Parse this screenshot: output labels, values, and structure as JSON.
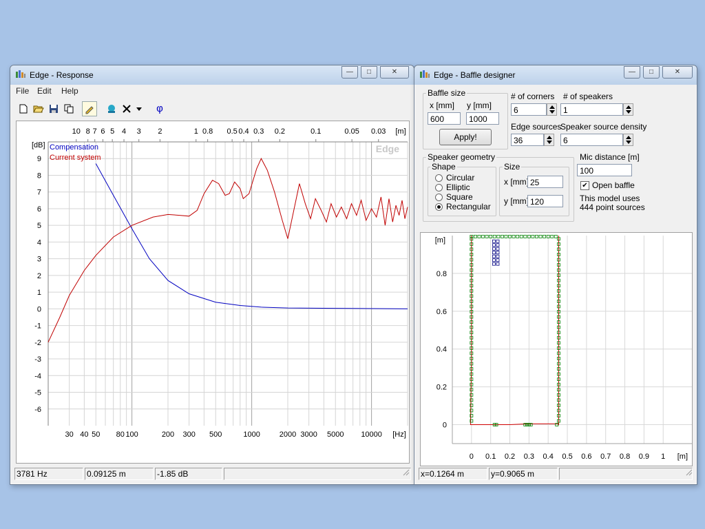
{
  "response_window": {
    "title": "Edge - Response",
    "menu": [
      "File",
      "Edit",
      "Help"
    ],
    "toolbar_icons": [
      "new-file-icon",
      "open-folder-icon",
      "save-icon",
      "copy-icon",
      "pencil-icon",
      "speaker-icon",
      "delete-icon",
      "dropdown-icon",
      "phase-icon"
    ],
    "phase_glyph": "φ",
    "status": [
      "3781 Hz",
      "0.09125 m",
      "-1.85 dB",
      ""
    ]
  },
  "chart_data": {
    "type": "line",
    "xscale": "log",
    "xlim": [
      20,
      20000
    ],
    "ylim": [
      -7,
      10
    ],
    "grid": true,
    "legend": "top-left",
    "watermark": "Edge",
    "ylabel": "[dB]",
    "xlabel": "[Hz]",
    "top_axis_label": "[m]",
    "yticks": [
      9,
      8,
      7,
      6,
      5,
      4,
      3,
      2,
      1,
      0,
      -1,
      -2,
      -3,
      -4,
      -5,
      -6
    ],
    "xtick_labels": [
      {
        "v": 30,
        "t": "30"
      },
      {
        "v": 40,
        "t": "40"
      },
      {
        "v": 50,
        "t": "50"
      },
      {
        "v": 80,
        "t": "80"
      },
      {
        "v": 100,
        "t": "100"
      },
      {
        "v": 200,
        "t": "200"
      },
      {
        "v": 300,
        "t": "300"
      },
      {
        "v": 500,
        "t": "500"
      },
      {
        "v": 1000,
        "t": "1000"
      },
      {
        "v": 2000,
        "t": "2000"
      },
      {
        "v": 3000,
        "t": "3000"
      },
      {
        "v": 5000,
        "t": "5000"
      },
      {
        "v": 10000,
        "t": "10000"
      }
    ],
    "top_tick_labels": [
      {
        "v": 34.3,
        "t": "10"
      },
      {
        "v": 42.9,
        "t": "8"
      },
      {
        "v": 49,
        "t": "7"
      },
      {
        "v": 57.2,
        "t": "6"
      },
      {
        "v": 68.6,
        "t": "5"
      },
      {
        "v": 85.8,
        "t": "4"
      },
      {
        "v": 114.3,
        "t": "3"
      },
      {
        "v": 171.5,
        "t": "2"
      },
      {
        "v": 343,
        "t": "1"
      },
      {
        "v": 428.8,
        "t": "0.8"
      },
      {
        "v": 686,
        "t": "0.5"
      },
      {
        "v": 857.5,
        "t": "0.4"
      },
      {
        "v": 1143,
        "t": "0.3"
      },
      {
        "v": 1715,
        "t": "0.2"
      },
      {
        "v": 3430,
        "t": "0.1"
      },
      {
        "v": 6860,
        "t": "0.05"
      },
      {
        "v": 11433,
        "t": "0.03"
      }
    ],
    "series": [
      {
        "name": "Compensation",
        "color": "#0000c0",
        "points": [
          [
            50,
            8.7
          ],
          [
            70,
            6.8
          ],
          [
            100,
            4.8
          ],
          [
            140,
            3.0
          ],
          [
            200,
            1.7
          ],
          [
            300,
            0.9
          ],
          [
            500,
            0.4
          ],
          [
            800,
            0.2
          ],
          [
            1200,
            0.1
          ],
          [
            2000,
            0.05
          ],
          [
            5000,
            0.03
          ],
          [
            20000,
            0.0
          ]
        ]
      },
      {
        "name": "Current system",
        "color": "#c00000",
        "points": [
          [
            20,
            -2.0
          ],
          [
            25,
            -0.5
          ],
          [
            30,
            0.8
          ],
          [
            40,
            2.3
          ],
          [
            50,
            3.2
          ],
          [
            70,
            4.3
          ],
          [
            100,
            5.0
          ],
          [
            150,
            5.5
          ],
          [
            200,
            5.65
          ],
          [
            250,
            5.6
          ],
          [
            300,
            5.55
          ],
          [
            350,
            5.9
          ],
          [
            400,
            6.9
          ],
          [
            470,
            7.7
          ],
          [
            530,
            7.5
          ],
          [
            600,
            6.8
          ],
          [
            650,
            6.9
          ],
          [
            720,
            7.6
          ],
          [
            800,
            7.2
          ],
          [
            850,
            6.6
          ],
          [
            950,
            6.9
          ],
          [
            1100,
            8.4
          ],
          [
            1200,
            9.0
          ],
          [
            1350,
            8.3
          ],
          [
            1550,
            7.0
          ],
          [
            1800,
            5.3
          ],
          [
            2000,
            4.2
          ],
          [
            2200,
            5.6
          ],
          [
            2500,
            7.5
          ],
          [
            2800,
            6.3
          ],
          [
            3100,
            5.4
          ],
          [
            3400,
            6.6
          ],
          [
            3800,
            5.9
          ],
          [
            4200,
            5.2
          ],
          [
            4600,
            6.3
          ],
          [
            5100,
            5.5
          ],
          [
            5600,
            6.1
          ],
          [
            6200,
            5.4
          ],
          [
            6800,
            6.3
          ],
          [
            7500,
            5.6
          ],
          [
            8200,
            6.5
          ],
          [
            9000,
            5.3
          ],
          [
            10000,
            6.0
          ],
          [
            11000,
            5.5
          ],
          [
            12000,
            6.7
          ],
          [
            13000,
            5.0
          ],
          [
            14000,
            6.6
          ],
          [
            15000,
            5.2
          ],
          [
            16000,
            6.2
          ],
          [
            17000,
            5.6
          ],
          [
            18000,
            6.5
          ],
          [
            19000,
            5.4
          ],
          [
            20000,
            6.1
          ]
        ]
      }
    ]
  },
  "baffle_window": {
    "title": "Edge - Baffle designer",
    "baffle_size": {
      "label": "Baffle size",
      "x_label": "x [mm]",
      "y_label": "y [mm]",
      "x_value": "600",
      "y_value": "1000",
      "apply_label": "Apply!"
    },
    "corners": {
      "label": "# of corners",
      "value": "6"
    },
    "speakers": {
      "label": "# of speakers",
      "value": "1"
    },
    "edge_sources": {
      "label": "Edge sources",
      "value": "36"
    },
    "density": {
      "label": "Speaker source density",
      "value": "6"
    },
    "geometry": {
      "label": "Speaker geometry",
      "shape_label": "Shape",
      "shapes": [
        "Circular",
        "Elliptic",
        "Square",
        "Rectangular"
      ],
      "selected_shape": "Rectangular",
      "size_label": "Size",
      "x_label": "x [mm]",
      "x_value": "25",
      "y_label": "y [mm]",
      "y_value": "120"
    },
    "mic": {
      "label": "Mic distance [m]",
      "value": "100"
    },
    "open_baffle": {
      "label": "Open baffle",
      "checked": true
    },
    "model_info": [
      "This model uses",
      "444 point sources"
    ],
    "status": [
      "x=0.1264 m",
      "y=0.9065 m",
      ""
    ],
    "plot": {
      "xlim": [
        -0.1,
        1.15
      ],
      "ylim": [
        -0.1,
        1.0
      ],
      "x_unit": "[m]",
      "y_unit": "[m]",
      "xticks": [
        [
          "0",
          0
        ],
        [
          "0.1",
          0.1
        ],
        [
          "0.2",
          0.2
        ],
        [
          "0.3",
          0.3
        ],
        [
          "0.4",
          0.4
        ],
        [
          "0.5",
          0.5
        ],
        [
          "0.6",
          0.6
        ],
        [
          "0.7",
          0.7
        ],
        [
          "0.8",
          0.8
        ],
        [
          "0.9",
          0.9
        ],
        [
          "1",
          1.0
        ]
      ],
      "yticks": [
        [
          "0",
          0
        ],
        [
          "0.2",
          0.2
        ],
        [
          "0.4",
          0.4
        ],
        [
          "0.6",
          0.6
        ],
        [
          "0.8",
          0.8
        ]
      ],
      "outline_color": "#d00000",
      "edge_source_color": "#008000",
      "speaker_color": "#000080",
      "outline": [
        [
          0,
          1.0
        ],
        [
          0,
          0.33
        ],
        [
          -0.005,
          0.0
        ],
        [
          0.2,
          0.0
        ],
        [
          0.3,
          0.005
        ],
        [
          0.45,
          0.005
        ],
        [
          0.455,
          0.0
        ],
        [
          0.455,
          1.0
        ]
      ]
    }
  }
}
